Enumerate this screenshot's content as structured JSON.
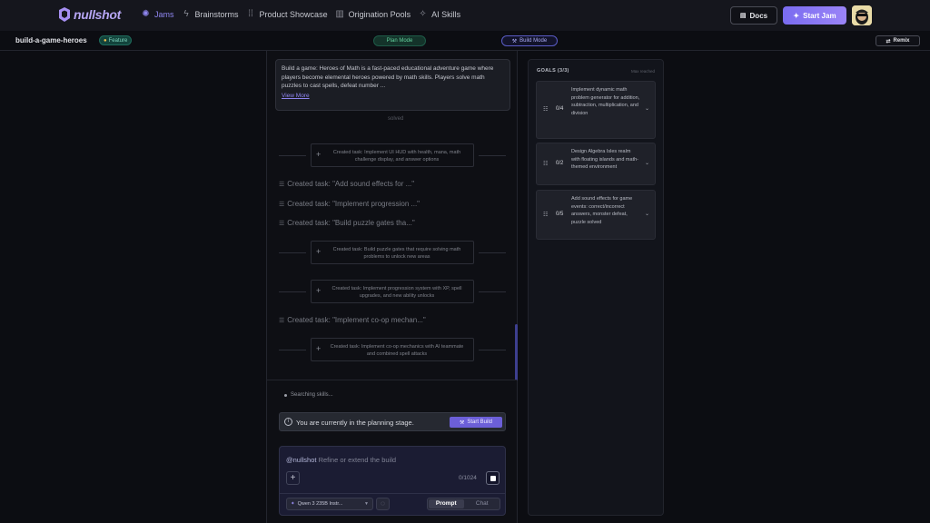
{
  "nav": {
    "logo": "nullshot",
    "items": [
      {
        "label": "Jams",
        "icon": "jams-icon",
        "active": true
      },
      {
        "label": "Brainstorms",
        "icon": "lightning-icon",
        "active": false
      },
      {
        "label": "Product Showcase",
        "icon": "grid-dots-icon",
        "active": false
      },
      {
        "label": "Origination Pools",
        "icon": "bar-chart-icon",
        "active": false
      },
      {
        "label": "AI Skills",
        "icon": "sparkle-icon",
        "active": false
      }
    ],
    "docs_label": "Docs",
    "start_jam_label": "Start Jam"
  },
  "subbar": {
    "project_name": "build-a-game-heroes",
    "feature_badge": "Feature",
    "plan_mode": "Plan Mode",
    "build_mode": "Build Mode",
    "remix": "Remix"
  },
  "description": {
    "text": "Build a game: Heroes of Math is a fast-paced educational adventure game where players become elemental heroes powered by math skills. Players solve math puzzles to cast spells, defeat number ...",
    "view_more": "View More"
  },
  "timeline": {
    "faded_text": "solved",
    "tasks": [
      {
        "type": "card",
        "text": "Created task: Implement UI HUD with health, mana, math challenge display, and answer options"
      },
      {
        "type": "line",
        "text": "Created task: \"Add sound effects for ...\""
      },
      {
        "type": "line",
        "text": "Created task: \"Implement progression ...\""
      },
      {
        "type": "line",
        "text": "Created task: \"Build puzzle gates tha...\""
      },
      {
        "type": "card",
        "text": "Created task: Build puzzle gates that require solving math problems to unlock new areas"
      },
      {
        "type": "card",
        "text": "Created task: Implement progression system with XP, spell upgrades, and new ability unlocks"
      },
      {
        "type": "line",
        "text": "Created task: \"Implement co-op mechan...\""
      },
      {
        "type": "card",
        "text": "Created task: Implement co-op mechanics with AI teammate and combined spell attacks"
      }
    ]
  },
  "chat": {
    "searching": "Searching skills...",
    "planning_notice": "You are currently in the planning stage.",
    "start_build": "Start Build",
    "prompt_handle": "@nullshot",
    "prompt_placeholder": "Refine or extend the build",
    "char_count": "0/1024",
    "model": "Qwen 3 235B Instr...",
    "mode_prompt": "Prompt",
    "mode_chat": "Chat"
  },
  "goals": {
    "header": "GOALS (3/3)",
    "max_reached": "Max reached",
    "items": [
      {
        "count": "0/4",
        "text": "Implement dynamic math problem generator for addition, subtraction, multiplication, and division"
      },
      {
        "count": "0/2",
        "text": "Design Algebra Isles realm with floating islands and math-themed environment"
      },
      {
        "count": "0/5",
        "text": "Add sound effects for game events: correct/incorrect answers, monster defeat, puzzle solved"
      }
    ]
  },
  "colors": {
    "accent": "#8f86f0",
    "background": "#0c0d12",
    "plan_green": "#63d29d"
  }
}
